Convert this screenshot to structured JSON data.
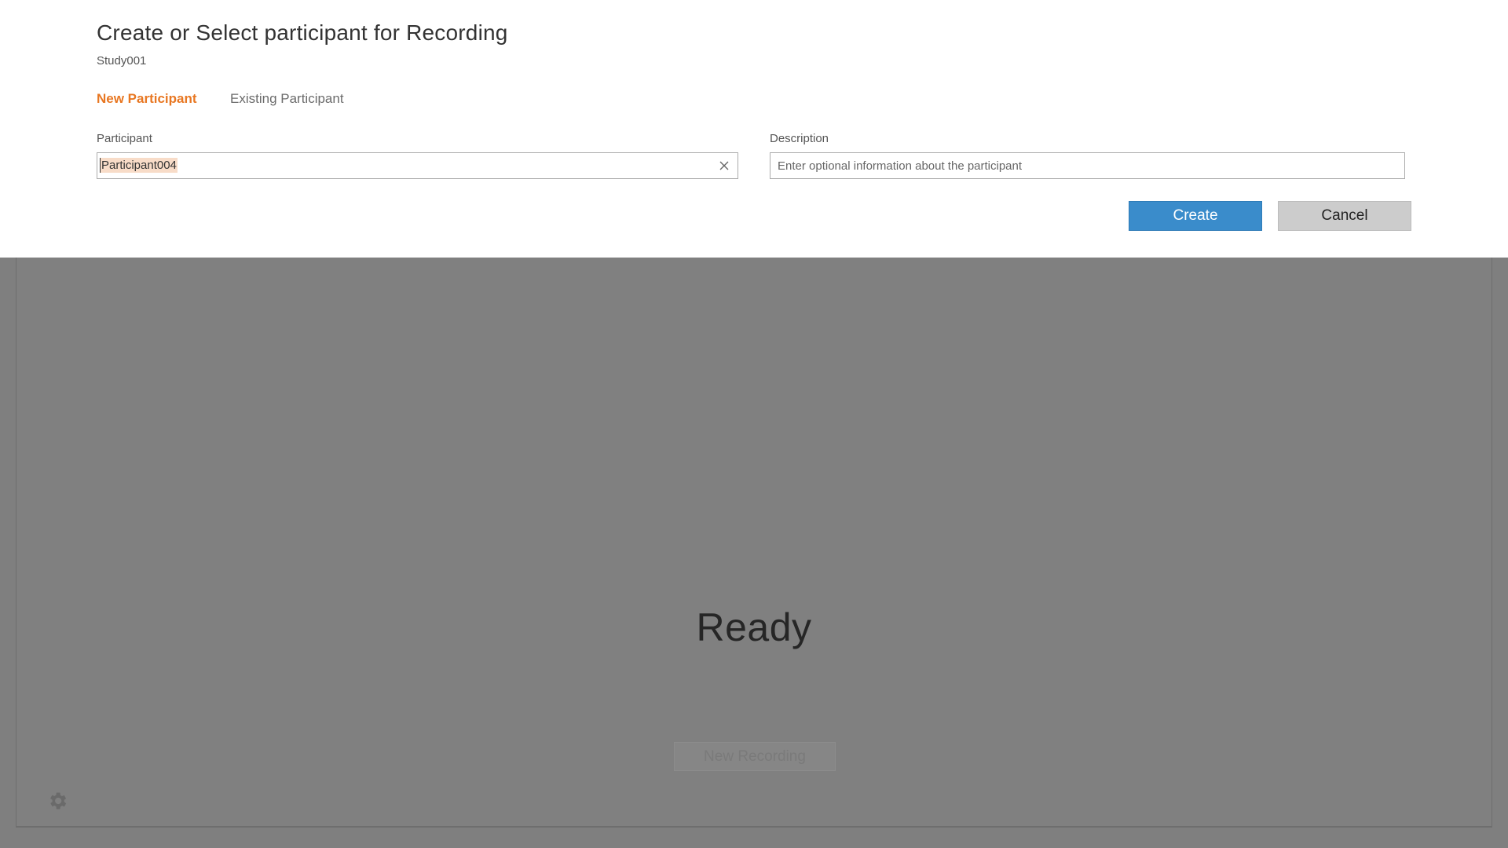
{
  "dialog": {
    "title": "Create or Select participant for Recording",
    "subtitle": "Study001",
    "tabs": [
      {
        "label": "New Participant",
        "active": true
      },
      {
        "label": "Existing Participant",
        "active": false
      }
    ],
    "participant": {
      "label": "Participant",
      "value": "Participant004"
    },
    "description": {
      "label": "Description",
      "placeholder": "Enter optional information about the participant"
    },
    "create_label": "Create",
    "cancel_label": "Cancel"
  },
  "background": {
    "status_text": "Ready",
    "new_recording_label": "New Recording",
    "settings_icon": "gear-icon"
  },
  "colors": {
    "accent": "#e87722",
    "primary_button": "#3a8ccb",
    "overlay": "#808080"
  }
}
